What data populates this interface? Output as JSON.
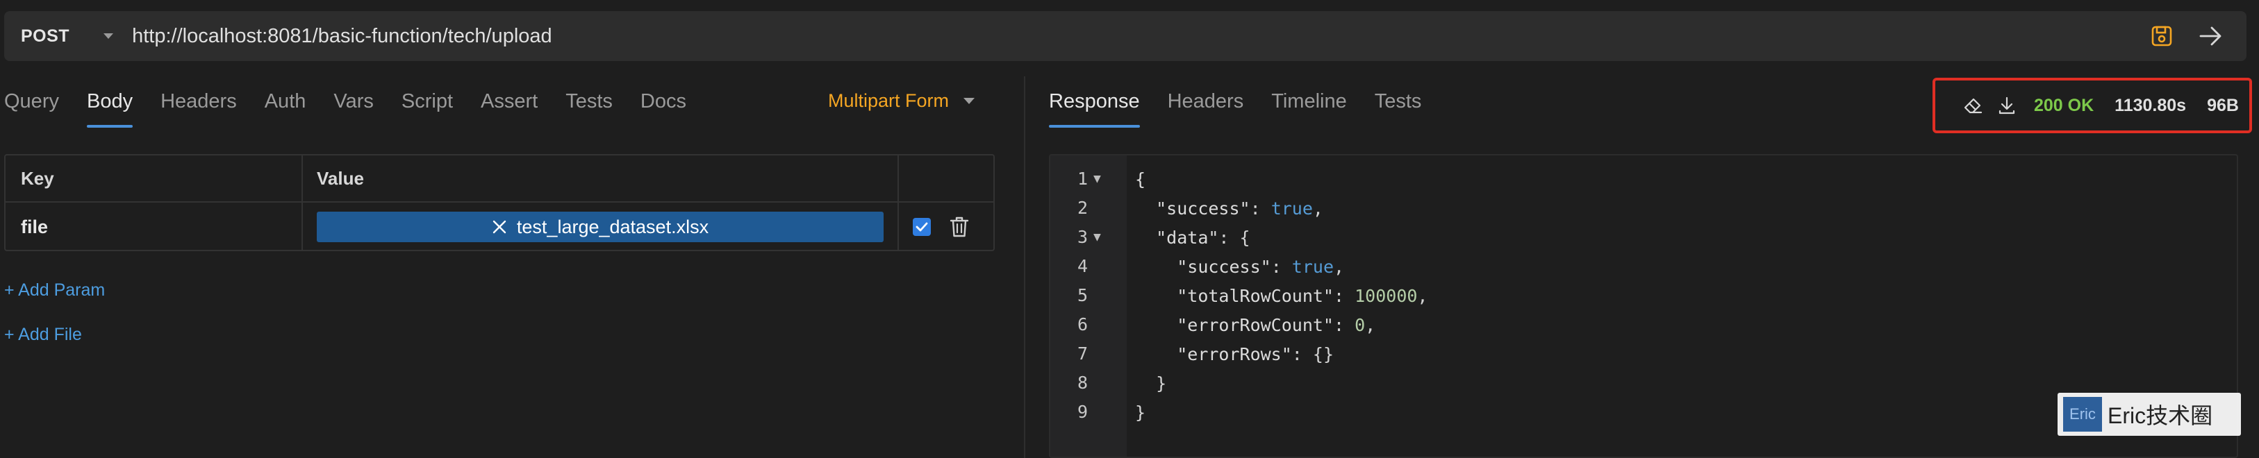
{
  "request": {
    "method": "POST",
    "url": "http://localhost:8081/basic-function/tech/upload"
  },
  "request_tabs": [
    "Query",
    "Body",
    "Headers",
    "Auth",
    "Vars",
    "Script",
    "Assert",
    "Tests",
    "Docs"
  ],
  "active_request_tab": "Body",
  "body_mode": "Multipart Form",
  "params_table": {
    "headers": {
      "key": "Key",
      "value": "Value"
    },
    "rows": [
      {
        "key": "file",
        "value": "test_large_dataset.xlsx",
        "enabled": true
      }
    ]
  },
  "add_param_label": "+ Add Param",
  "add_file_label": "+ Add File",
  "response_tabs": [
    "Response",
    "Headers",
    "Timeline",
    "Tests"
  ],
  "active_response_tab": "Response",
  "response_status": {
    "status": "200 OK",
    "time": "1130.80s",
    "size": "96B"
  },
  "response_body": {
    "line_numbers": [
      "1",
      "2",
      "3",
      "4",
      "5",
      "6",
      "7",
      "8",
      "9"
    ],
    "tokens": {
      "open_brace": "{",
      "success_key": "\"success\"",
      "colon": ": ",
      "true_value": "true",
      "comma": ",",
      "data_key": "\"data\"",
      "total_key": "\"totalRowCount\"",
      "total_value": "100000",
      "error_count_key": "\"errorRowCount\"",
      "error_count_value": "0",
      "error_rows_key": "\"errorRows\"",
      "empty_obj": "{}",
      "close_brace": "}"
    }
  },
  "watermark": {
    "logo_text": "Eric",
    "text": "Eric技术圈"
  },
  "colors": {
    "accent_tab": "#4a90d9",
    "body_mode": "#f5a623",
    "status_ok": "#7dc94a",
    "highlight_box": "#e02e24",
    "link": "#4d9de0"
  }
}
